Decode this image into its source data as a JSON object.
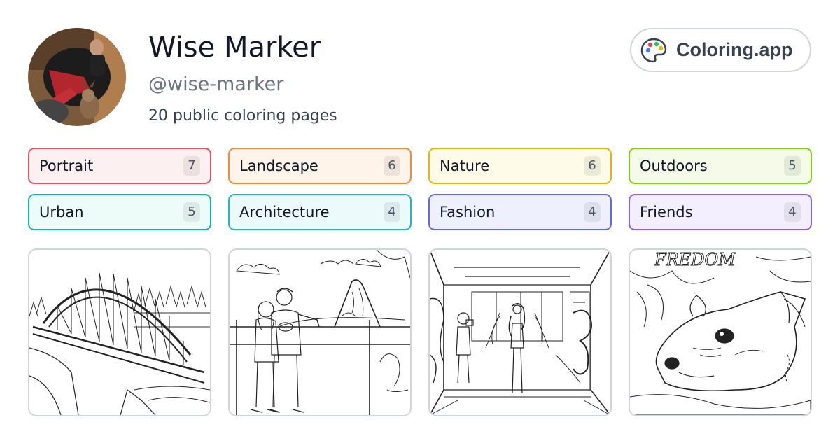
{
  "profile": {
    "name": "Wise Marker",
    "handle": "@wise-marker",
    "page_count_text": "20 public coloring pages",
    "avatar_icon": "user-avatar-photo"
  },
  "brand": {
    "label": "Coloring.app",
    "icon": "palette-icon"
  },
  "tags": [
    {
      "label": "Portrait",
      "count": "7",
      "border": "#e25563",
      "bg": "#fdf0f1"
    },
    {
      "label": "Landscape",
      "count": "6",
      "border": "#f08a3c",
      "bg": "#fef4ea"
    },
    {
      "label": "Nature",
      "count": "6",
      "border": "#eab308",
      "bg": "#fefce8"
    },
    {
      "label": "Outdoors",
      "count": "5",
      "border": "#84cc16",
      "bg": "#f5fbe8"
    },
    {
      "label": "Urban",
      "count": "5",
      "border": "#14b8a6",
      "bg": "#eefcf9"
    },
    {
      "label": "Architecture",
      "count": "4",
      "border": "#22b5c6",
      "bg": "#ecfafc"
    },
    {
      "label": "Fashion",
      "count": "4",
      "border": "#6366f1",
      "bg": "#eef0fe"
    },
    {
      "label": "Friends",
      "count": "4",
      "border": "#8b5cf6",
      "bg": "#f4effe"
    }
  ],
  "thumbnails": [
    {
      "subject": "arch bridge over river"
    },
    {
      "subject": "couple at mountain overlook"
    },
    {
      "subject": "fashion model in graffiti tunnel"
    },
    {
      "subject": "dog portrait with graffiti",
      "text": "FREEDOM"
    }
  ]
}
